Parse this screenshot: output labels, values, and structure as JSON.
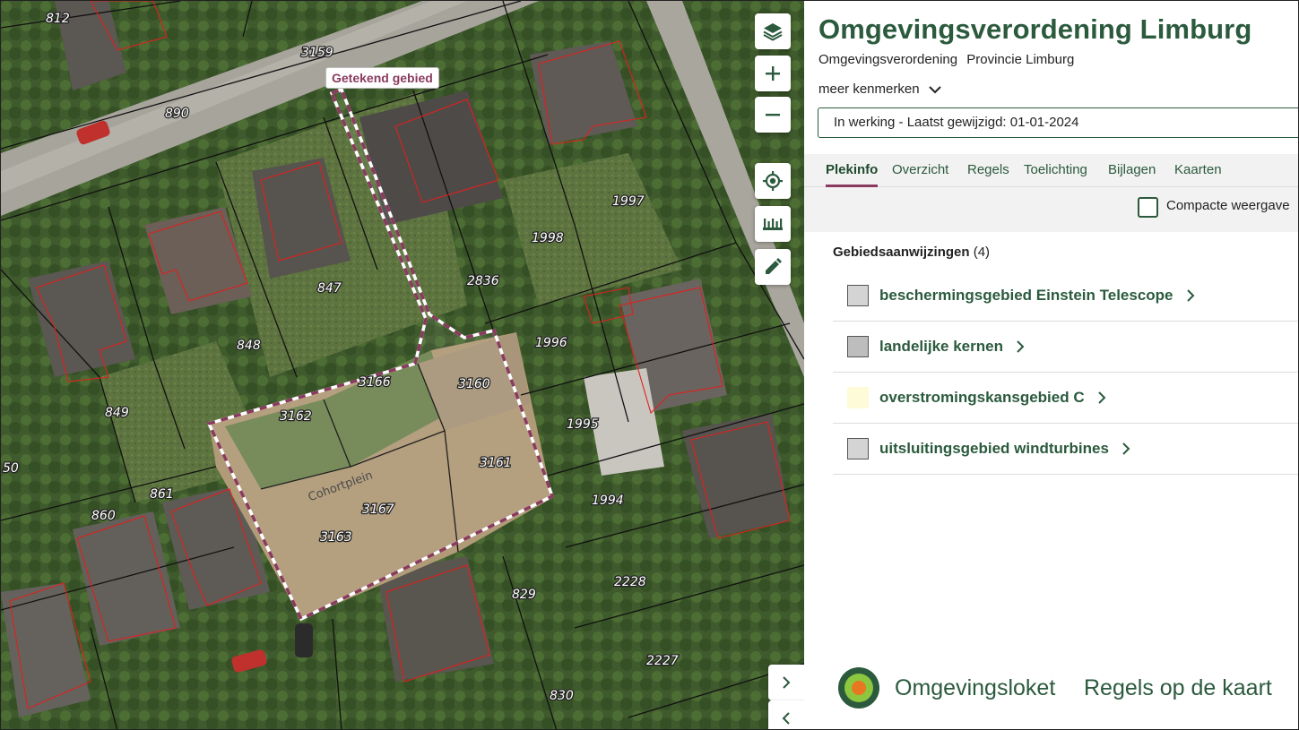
{
  "map": {
    "drawn_area_label": "Getekend gebied",
    "street_name": "Cohortplein",
    "parcel_numbers": [
      "812",
      "3159",
      "890",
      "847",
      "2836",
      "1998",
      "1997",
      "848",
      "3166",
      "3160",
      "1996",
      "849",
      "3162",
      "1995",
      "3161",
      "50",
      "861",
      "Cohortplein",
      "3167",
      "1994",
      "860",
      "3163",
      "2228",
      "829",
      "2227",
      "830"
    ],
    "controls": {
      "layers": "layers-icon",
      "zoom_in": "plus-icon",
      "zoom_out": "minus-icon",
      "locate": "locate-icon",
      "measure": "ruler-icon",
      "draw": "pencil-icon",
      "expand": "chevron-right-icon",
      "collapse": "chevron-left-icon"
    }
  },
  "panel": {
    "title": "Omgevingsverordening Limburg",
    "subtitle_type": "Omgevingsverordening",
    "subtitle_authority": "Provincie Limburg",
    "meer_kenmerken": "meer kenmerken",
    "status": "In werking - Laatst gewijzigd: 01-01-2024",
    "tabs": [
      "Plekinfo",
      "Overzicht",
      "Regels",
      "Toelichting",
      "Bijlagen",
      "Kaarten"
    ],
    "active_tab": "Plekinfo",
    "compact_label": "Compacte weergave",
    "compact_checked": false,
    "section_title": "Gebiedsaanwijzingen",
    "section_count": "(4)",
    "gebieden": [
      {
        "label": "beschermingsgebied Einstein Telescope",
        "color": "#d4d4d4"
      },
      {
        "label": "landelijke kernen",
        "color": "#bdbdbd"
      },
      {
        "label": "overstromingskansgebied C",
        "color": "#fdfbd8"
      },
      {
        "label": "uitsluitingsgebied windturbines",
        "color": "#d4d4d4"
      }
    ],
    "footer": {
      "brand_prefix": "Omgevings",
      "brand_suffix": "loket",
      "tagline": "Regels op de kaart"
    }
  },
  "colors": {
    "brand_green": "#2b5a3d",
    "accent_purple": "#8a3a5e",
    "parcel_red": "#e0201d"
  }
}
